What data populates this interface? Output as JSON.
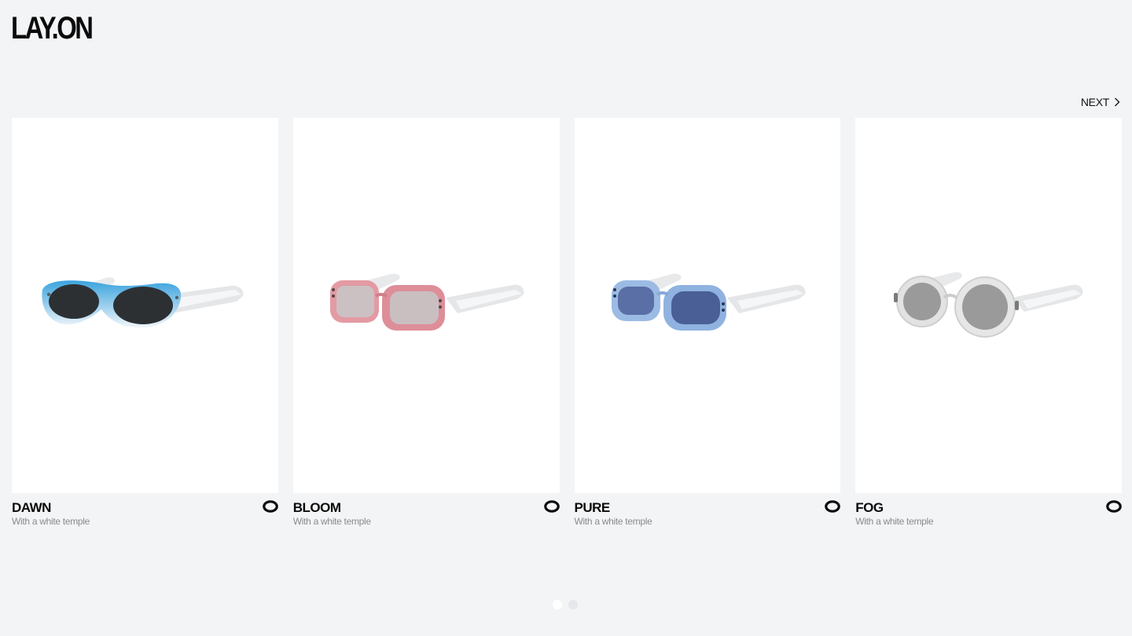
{
  "brand": {
    "logo_text": "LAY.ON"
  },
  "nav": {
    "next_label": "NEXT",
    "next_icon": "chevron-right-icon"
  },
  "products": [
    {
      "title": "DAWN",
      "subtitle": "With a white temple",
      "icon": "lens-ring-icon",
      "frame_color": "#5aaee0",
      "lens_color": "#2d3033"
    },
    {
      "title": "BLOOM",
      "subtitle": "With a white temple",
      "icon": "lens-ring-icon",
      "frame_color": "#dd8e98",
      "lens_color": "#c9bfc1"
    },
    {
      "title": "PURE",
      "subtitle": "With a white temple",
      "icon": "lens-ring-icon",
      "frame_color": "#8fb2e0",
      "lens_color": "#4a5f95"
    },
    {
      "title": "FOG",
      "subtitle": "With a white temple",
      "icon": "lens-ring-icon",
      "frame_color": "#e2e2e2",
      "lens_color": "#9a9a9a"
    }
  ],
  "pagination": {
    "total": 2,
    "active": 1
  }
}
